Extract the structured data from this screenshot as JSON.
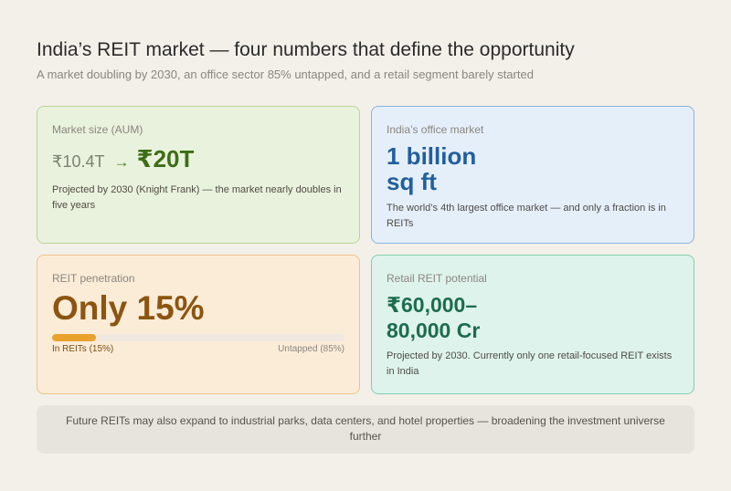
{
  "header": {
    "title": "India’s REIT market — four numbers that define the opportunity",
    "subtitle": "A market doubling by 2030, an office sector 85% untapped, and a retail segment barely started"
  },
  "cards": {
    "market_size": {
      "label": "Market size (AUM)",
      "from_value": "₹10.4T",
      "arrow": "→",
      "to_value": "₹20T",
      "description": "Projected by 2030 (Knight Frank) — the market nearly doubles in five years"
    },
    "office_market": {
      "label": "India’s office market",
      "value_line1": "1 billion",
      "value_line2": "sq ft",
      "description": "The world’s 4th largest office market — and only a fraction is in REITs"
    },
    "penetration": {
      "label": "REIT penetration",
      "value": "Only 15%",
      "progress_fraction": 0.15,
      "bar_left_label": "In REITs (15%)",
      "bar_right_label": "Untapped (85%)"
    },
    "retail": {
      "label": "Retail REIT potential",
      "value_line1": "₹60,000–",
      "value_line2": "80,000 Cr",
      "description": "Projected by 2030. Currently only one retail-focused REIT exists in India"
    }
  },
  "footer": {
    "note": "Future REITs may also expand to industrial parks, data centers, and hotel properties — broadening the investment universe further"
  },
  "colors": {
    "background": "#f3f0ea",
    "market_accent": "#3d6e17",
    "office_accent": "#215f9c",
    "penetration_accent": "#8c5510",
    "progress_fill": "#e9a22c",
    "retail_accent": "#1d6c4f"
  }
}
